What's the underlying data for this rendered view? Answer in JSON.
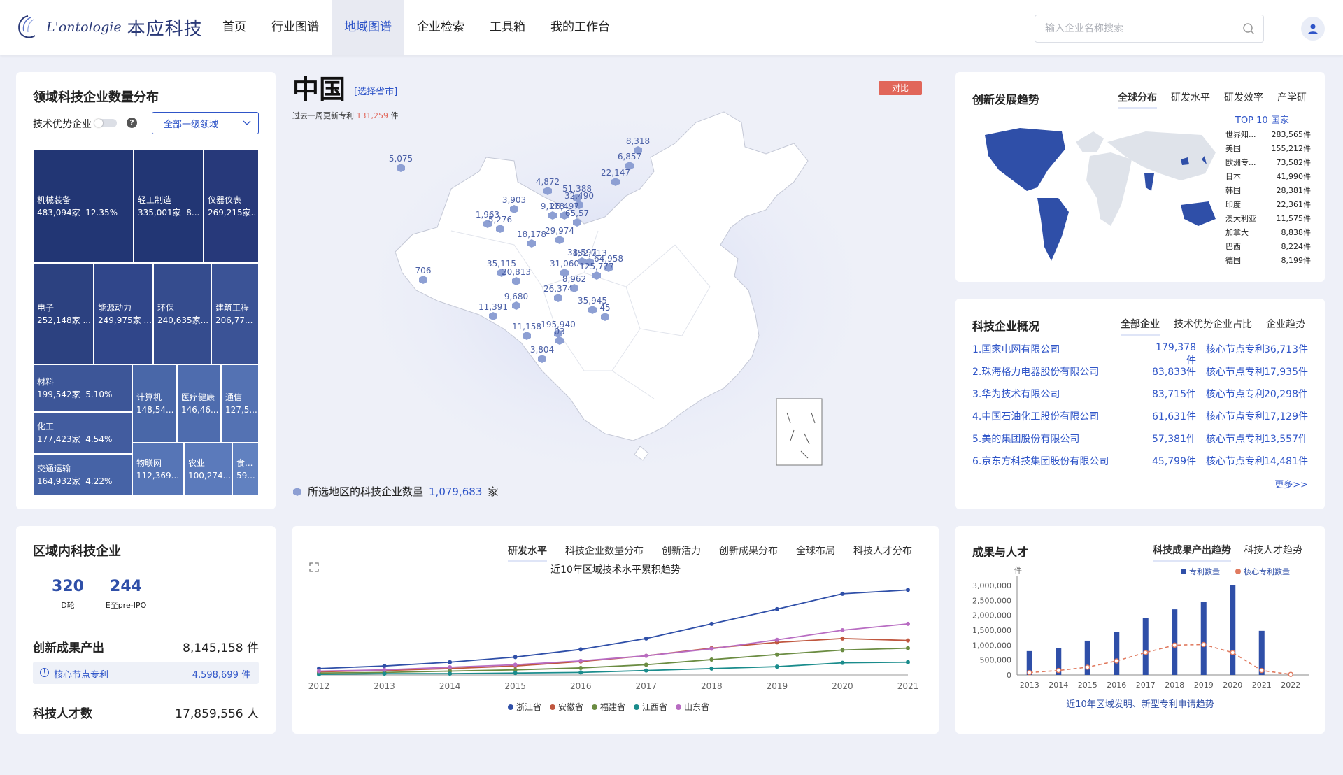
{
  "header": {
    "logo_en": "L'ontologie",
    "logo_cn": "本应科技",
    "nav": [
      "首页",
      "行业图谱",
      "地域图谱",
      "企业检索",
      "工具箱",
      "我的工作台"
    ],
    "active_nav": 2,
    "search_placeholder": "输入企业名称搜索"
  },
  "domain_panel": {
    "title": "领域科技企业数量分布",
    "toggle_label": "技术优势企业",
    "select_value": "全部一级领域",
    "treemap": [
      {
        "name": "机械装备",
        "value": "483,094家",
        "pct": "12.35%"
      },
      {
        "name": "轻工制造",
        "value": "335,001家",
        "pct": "8..."
      },
      {
        "name": "仪器仪表",
        "value": "269,215家...",
        "pct": ""
      },
      {
        "name": "电子",
        "value": "252,148家 ...",
        "pct": ""
      },
      {
        "name": "能源动力",
        "value": "249,975家 ...",
        "pct": ""
      },
      {
        "name": "环保",
        "value": "240,635家...",
        "pct": ""
      },
      {
        "name": "建筑工程",
        "value": "206,77...",
        "pct": ""
      },
      {
        "name": "材料",
        "value": "199,542家",
        "pct": "5.10%"
      },
      {
        "name": "化工",
        "value": "177,423家",
        "pct": "4.54%"
      },
      {
        "name": "交通运输",
        "value": "164,932家",
        "pct": "4.22%"
      },
      {
        "name": "计算机",
        "value": "148,54...",
        "pct": ""
      },
      {
        "name": "医疗健康",
        "value": "146,46...",
        "pct": ""
      },
      {
        "name": "通信",
        "value": "127,5...",
        "pct": ""
      },
      {
        "name": "物联网",
        "value": "112,369...",
        "pct": ""
      },
      {
        "name": "农业",
        "value": "100,274...",
        "pct": ""
      },
      {
        "name": "食...",
        "value": "59...",
        "pct": ""
      }
    ]
  },
  "map_panel": {
    "title": "中国",
    "select_link": "[选择省市]",
    "compare_label": "对比",
    "update_prefix": "过去一周更新专利",
    "update_value": "131,259",
    "update_suffix": "件",
    "footer_prefix": "所选地区的科技企业数量",
    "footer_value": "1,079,683",
    "footer_suffix": "家",
    "markers": [
      "5,075",
      "8,318",
      "6,857",
      "22,147",
      "4,872",
      "51,388",
      "32,490",
      "9,178",
      "26,497",
      "65,57",
      "3,903",
      "1,963",
      "5,276",
      "18,178",
      "29,974",
      "706",
      "35,115",
      "20,813",
      "31,060",
      "38,597",
      "152,013",
      "64,958",
      "125,777",
      "8,962",
      "26,374",
      "9,680",
      "35,945",
      "45",
      "11,391",
      "11,158",
      "195,940",
      "03",
      "3,804"
    ]
  },
  "innovation_panel": {
    "title": "创新发展趋势",
    "tabs": [
      "全球分布",
      "研发水平",
      "研发效率",
      "产学研"
    ],
    "top10_title": "TOP 10 国家",
    "countries": [
      {
        "name": "世界知...",
        "value": "283,565件"
      },
      {
        "name": "美国",
        "value": "155,212件"
      },
      {
        "name": "欧洲专...",
        "value": "73,582件"
      },
      {
        "name": "日本",
        "value": "41,990件"
      },
      {
        "name": "韩国",
        "value": "28,381件"
      },
      {
        "name": "印度",
        "value": "22,361件"
      },
      {
        "name": "澳大利亚",
        "value": "11,575件"
      },
      {
        "name": "加拿大",
        "value": "8,838件"
      },
      {
        "name": "巴西",
        "value": "8,224件"
      },
      {
        "name": "德国",
        "value": "8,199件"
      }
    ]
  },
  "companies_panel": {
    "title": "科技企业概况",
    "tabs": [
      "全部企业",
      "技术优势企业占比",
      "企业趋势"
    ],
    "node_label": "核心节点专利",
    "rows": [
      {
        "name": "1.国家电网有限公司",
        "patents": "179,378件",
        "core": "36,713件"
      },
      {
        "name": "2.珠海格力电器股份有限公司",
        "patents": "83,833件",
        "core": "17,935件"
      },
      {
        "name": "3.华为技术有限公司",
        "patents": "83,715件",
        "core": "20,298件"
      },
      {
        "name": "4.中国石油化工股份有限公司",
        "patents": "61,631件",
        "core": "17,129件"
      },
      {
        "name": "5.美的集团股份有限公司",
        "patents": "57,381件",
        "core": "13,557件"
      },
      {
        "name": "6.京东方科技集团股份有限公司",
        "patents": "45,799件",
        "core": "14,481件"
      }
    ],
    "more": "更多>>"
  },
  "region_panel": {
    "title": "区域内科技企业",
    "stats": [
      {
        "value": "320",
        "label": "D轮"
      },
      {
        "value": "244",
        "label": "E至pre-IPO"
      }
    ],
    "output_label": "创新成果产出",
    "output_value": "8,145,158 件",
    "core_label": "核心节点专利",
    "core_value": "4,598,699 件",
    "talent_label": "科技人才数",
    "talent_value": "17,859,556 人"
  },
  "trend_panel": {
    "tabs": [
      "研发水平",
      "科技企业数量分布",
      "创新活力",
      "创新成果分布",
      "全球布局",
      "科技人才分布"
    ]
  },
  "output_panel": {
    "title": "成果与人才",
    "tabs": [
      "科技成果产出趋势",
      "科技人才趋势"
    ]
  },
  "chart_data": [
    {
      "type": "line",
      "title": "近10年区域技术水平累积趋势",
      "x": [
        "2012",
        "2013",
        "2014",
        "2015",
        "2016",
        "2017",
        "2018",
        "2019",
        "2020",
        "2021"
      ],
      "series": [
        {
          "name": "浙江省",
          "color": "#2f4fa8",
          "values": [
            10,
            14,
            20,
            28,
            40,
            57,
            80,
            103,
            127,
            133
          ]
        },
        {
          "name": "安徽省",
          "color": "#c0573f",
          "values": [
            5,
            7,
            10,
            14,
            21,
            30,
            42,
            51,
            57,
            54
          ]
        },
        {
          "name": "福建省",
          "color": "#6b8c42",
          "values": [
            3,
            4,
            6,
            8,
            11,
            16,
            24,
            32,
            39,
            42
          ]
        },
        {
          "name": "江西省",
          "color": "#1a8c8c",
          "values": [
            1,
            2,
            2,
            3,
            4,
            7,
            10,
            13,
            19,
            20
          ]
        },
        {
          "name": "山东省",
          "color": "#b86cc2",
          "values": [
            6,
            8,
            12,
            16,
            22,
            30,
            41,
            55,
            70,
            80
          ]
        }
      ]
    },
    {
      "type": "bar",
      "title": "近10年区域发明、新型专利申请趋势",
      "ylabel": "件",
      "ylim": [
        0,
        3000000
      ],
      "yticks": [
        "3,000,000",
        "2,500,000",
        "2,000,000",
        "1,500,000",
        "1,000,000",
        "500,000",
        "0"
      ],
      "categories": [
        "2013",
        "2014",
        "2015",
        "2016",
        "2017",
        "2018",
        "2019",
        "2020",
        "2021",
        "2022"
      ],
      "series": [
        {
          "name": "专利数量",
          "color": "#2f4fa8",
          "values": [
            800000,
            900000,
            1150000,
            1450000,
            1900000,
            2200000,
            2450000,
            3000000,
            1480000,
            0
          ]
        },
        {
          "name": "核心专利数量",
          "color": "#e07a5f",
          "values": [
            80000,
            150000,
            260000,
            470000,
            750000,
            1000000,
            1020000,
            750000,
            150000,
            20000
          ]
        }
      ]
    }
  ]
}
